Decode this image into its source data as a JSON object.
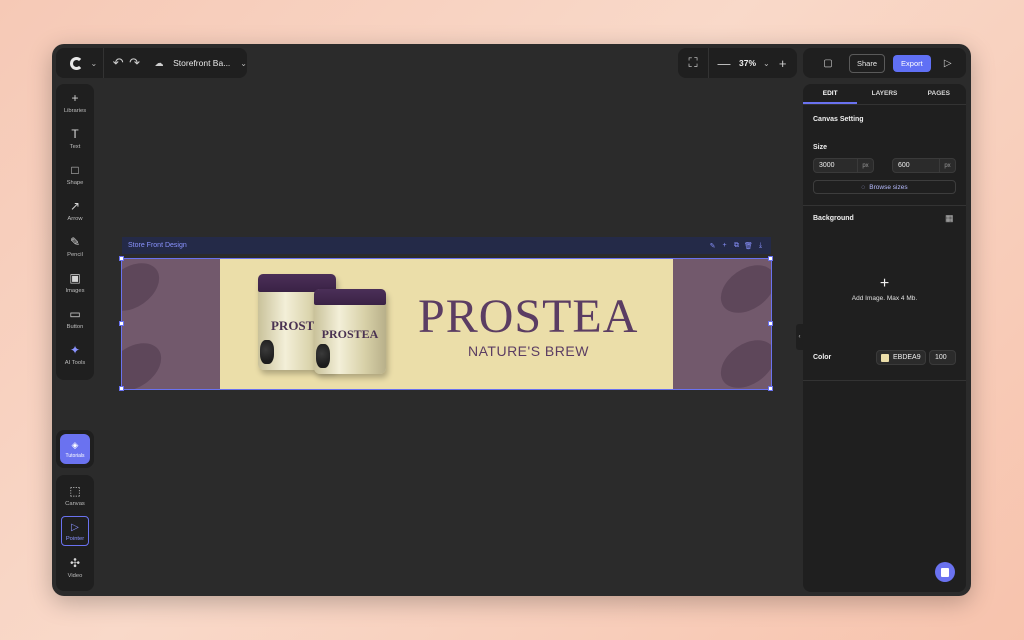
{
  "app": {
    "project_name": "Storefront Ba...",
    "zoom": "37%",
    "share_label": "Share",
    "export_label": "Export"
  },
  "icons": {
    "logo": "g-logo-icon",
    "undo": "undo-icon",
    "redo": "redo-icon",
    "cloud": "cloud-icon",
    "fit": "fit-screen-icon",
    "comment": "comment-icon",
    "play": "play-icon"
  },
  "toolbar": {
    "items": [
      {
        "label": "Libraries",
        "glyph": "+"
      },
      {
        "label": "Text",
        "glyph": "T"
      },
      {
        "label": "Shape",
        "glyph": "□"
      },
      {
        "label": "Arrow",
        "glyph": "↗"
      },
      {
        "label": "Pencil",
        "glyph": "✎"
      },
      {
        "label": "Images",
        "glyph": "▣"
      },
      {
        "label": "Button",
        "glyph": "▭"
      },
      {
        "label": "AI Tools",
        "glyph": "✦"
      }
    ],
    "tutorials": "Tutorials",
    "bottom": [
      {
        "label": "Canvas",
        "glyph": "⬚"
      },
      {
        "label": "Pointer",
        "glyph": "▷"
      },
      {
        "label": "Video",
        "glyph": "✣"
      }
    ]
  },
  "canvas": {
    "artboard_name": "Store Front Design",
    "background": "#EBDEA9",
    "side_color": "#72596C",
    "brand_title": "PROSTEA",
    "brand_subtitle": "NATURE'S BREW",
    "jar_text": "PROSTE",
    "jar_text_small": "PROSTEA"
  },
  "right_panel": {
    "tabs": [
      "EDIT",
      "LAYERS",
      "PAGES"
    ],
    "canvas_setting": "Canvas Setting",
    "size_label": "Size",
    "width": "3000",
    "height": "600",
    "unit": "px",
    "browse_sizes": "Browse sizes",
    "background_label": "Background",
    "add_image": "Add Image. Max 4 Mb.",
    "color_label": "Color",
    "color_hex": "EBDEA9",
    "opacity": "100"
  },
  "colors": {
    "accent": "#6A72F0",
    "bg_dark": "#2B2B2B",
    "panel": "#1F1F1F"
  }
}
